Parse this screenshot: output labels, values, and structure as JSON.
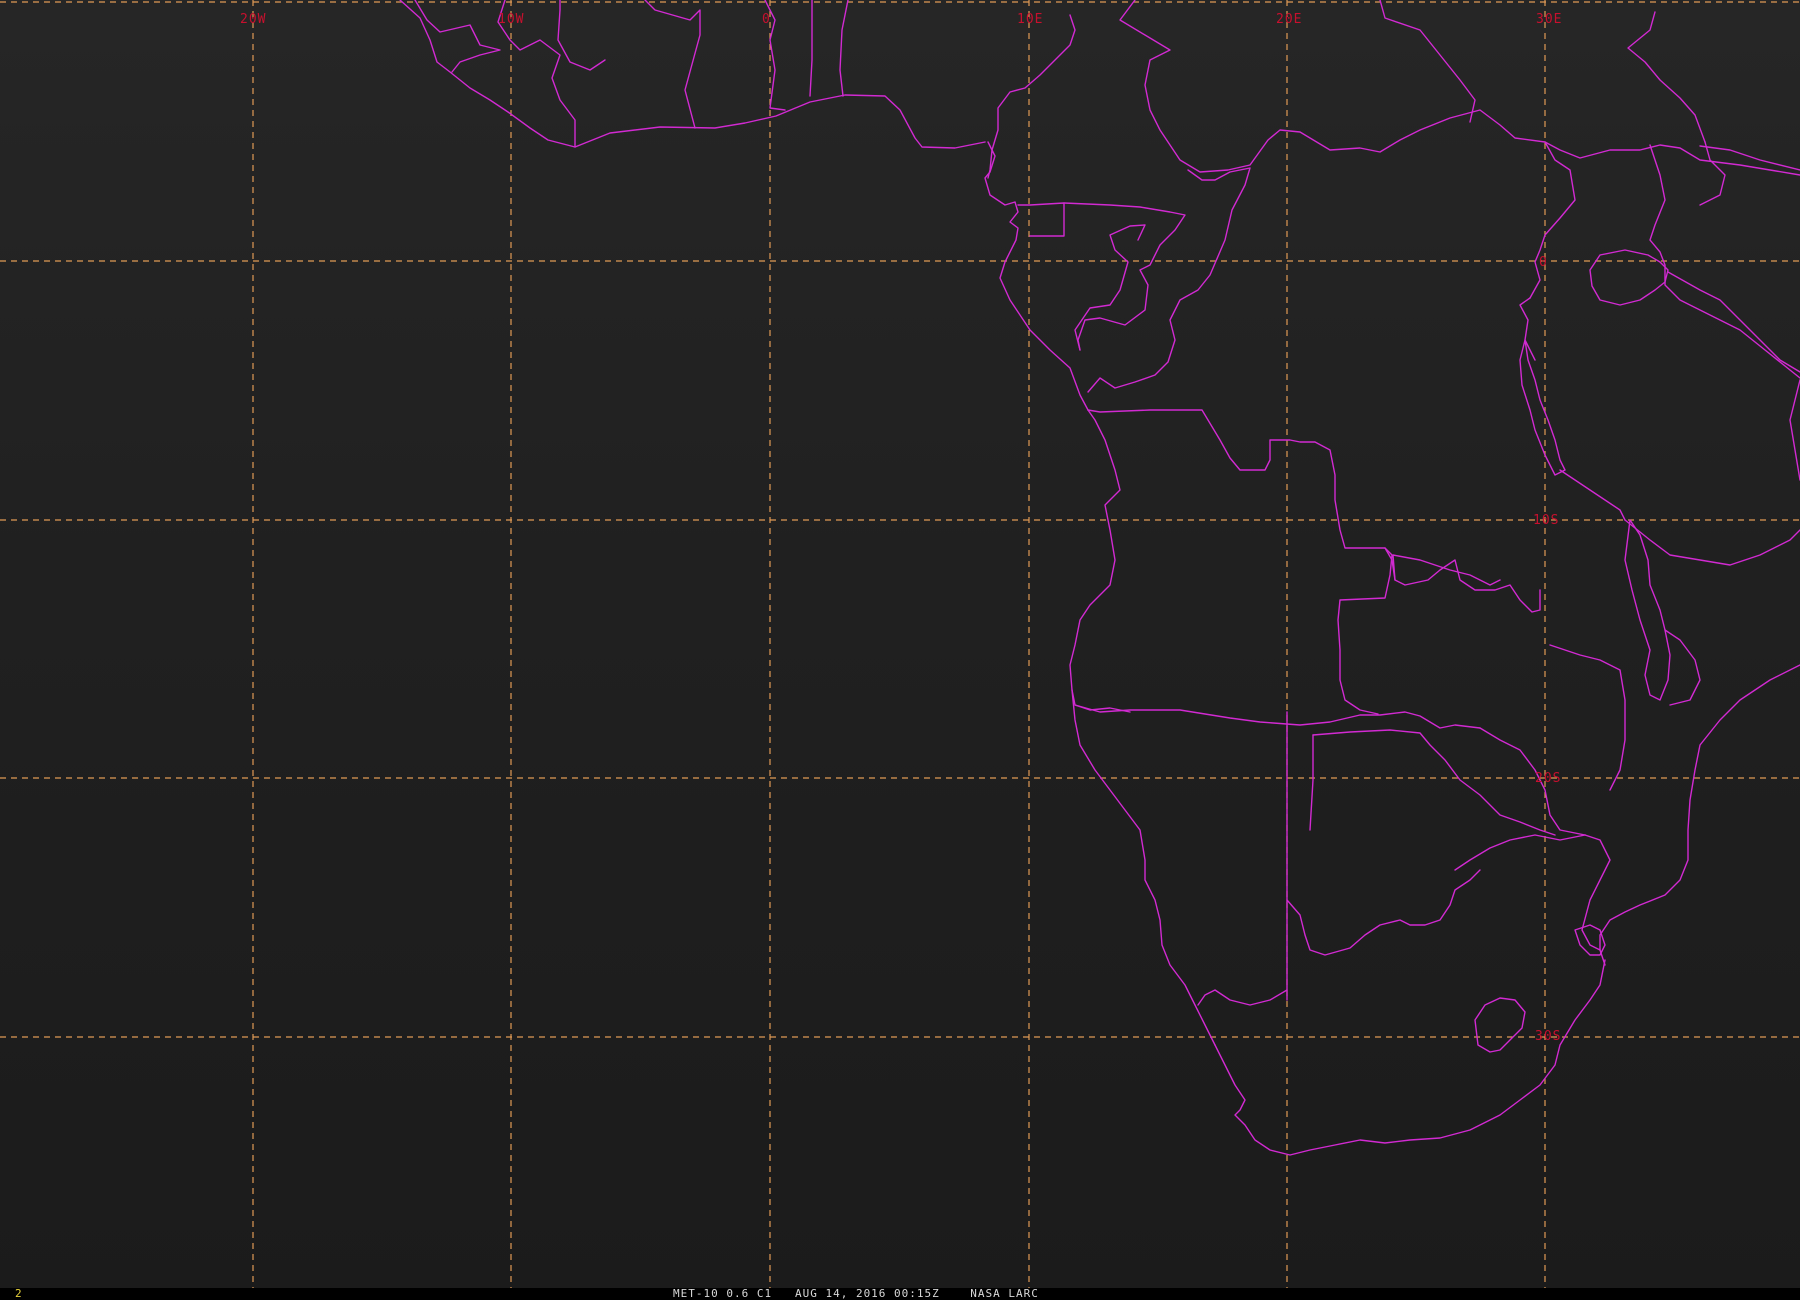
{
  "image": {
    "frame_number": "2",
    "caption": "MET-10 0.6 C1   AUG 14, 2016 00:15Z    NASA LARC"
  },
  "grid": {
    "longitude_labels": [
      "20W",
      "10W",
      "0",
      "10E",
      "20E",
      "30E"
    ],
    "latitude_labels": [
      "0",
      "10S",
      "20S",
      "30S"
    ]
  },
  "colors": {
    "background": "#1f1f1f",
    "grid_lines": "#e09a55",
    "grid_labels": "#c8102e",
    "country_borders": "#d22ad2",
    "frame_number": "#e8d23a"
  },
  "icons": {
    "borders": "country-border-lines",
    "grid": "lat-lon-graticule"
  }
}
